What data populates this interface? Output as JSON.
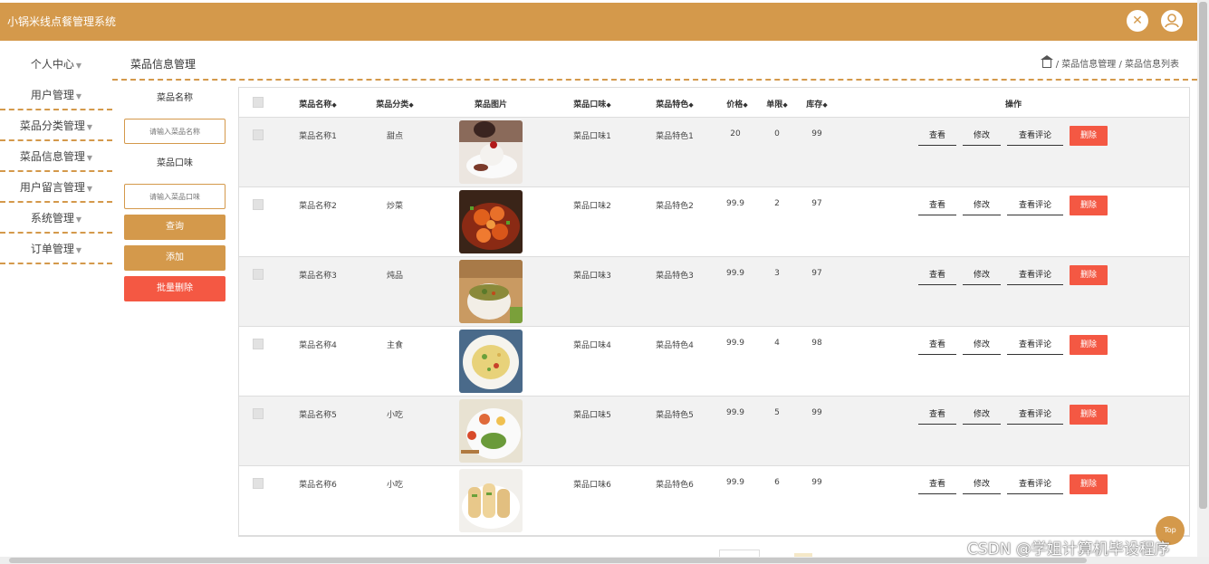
{
  "app": {
    "title": "小锅米线点餐管理系统"
  },
  "topbar": {
    "close_icon": "close-icon",
    "user_icon": "user-icon",
    "color": "#d4994b"
  },
  "sidebar": {
    "items": [
      {
        "label": "个人中心"
      },
      {
        "label": "用户管理"
      },
      {
        "label": "菜品分类管理"
      },
      {
        "label": "菜品信息管理"
      },
      {
        "label": "用户留言管理"
      },
      {
        "label": "系统管理"
      },
      {
        "label": "订单管理"
      }
    ]
  },
  "page": {
    "title": "菜品信息管理",
    "breadcrumb": [
      "菜品信息管理",
      "菜品信息列表"
    ]
  },
  "search": {
    "name_label": "菜品名称",
    "name_placeholder": "请输入菜品名称",
    "taste_label": "菜品口味",
    "taste_placeholder": "请输入菜品口味",
    "query_label": "查询",
    "add_label": "添加",
    "batch_delete_label": "批量删除"
  },
  "table": {
    "headers": {
      "name": "菜品名称",
      "category": "菜品分类",
      "image": "菜品图片",
      "taste": "菜品口味",
      "feature": "菜品特色",
      "price": "价格",
      "limit": "单限",
      "stock": "库存",
      "actions": "操作"
    },
    "rows": [
      {
        "name": "菜品名称1",
        "category": "甜点",
        "taste": "菜品口味1",
        "feature": "菜品特色1",
        "price": "20",
        "limit": "0",
        "stock": "99"
      },
      {
        "name": "菜品名称2",
        "category": "炒菜",
        "taste": "菜品口味2",
        "feature": "菜品特色2",
        "price": "99.9",
        "limit": "2",
        "stock": "97"
      },
      {
        "name": "菜品名称3",
        "category": "炖品",
        "taste": "菜品口味3",
        "feature": "菜品特色3",
        "price": "99.9",
        "limit": "3",
        "stock": "97"
      },
      {
        "name": "菜品名称4",
        "category": "主食",
        "taste": "菜品口味4",
        "feature": "菜品特色4",
        "price": "99.9",
        "limit": "4",
        "stock": "98"
      },
      {
        "name": "菜品名称5",
        "category": "小吃",
        "taste": "菜品口味5",
        "feature": "菜品特色5",
        "price": "99.9",
        "limit": "5",
        "stock": "99"
      },
      {
        "name": "菜品名称6",
        "category": "小吃",
        "taste": "菜品口味6",
        "feature": "菜品特色6",
        "price": "99.9",
        "limit": "6",
        "stock": "99"
      }
    ],
    "actions": {
      "view": "查看",
      "edit": "修改",
      "comments": "查看评论",
      "delete": "删除"
    }
  },
  "top_button": "Top",
  "watermark": "CSDN @学姐计算机毕设程序"
}
